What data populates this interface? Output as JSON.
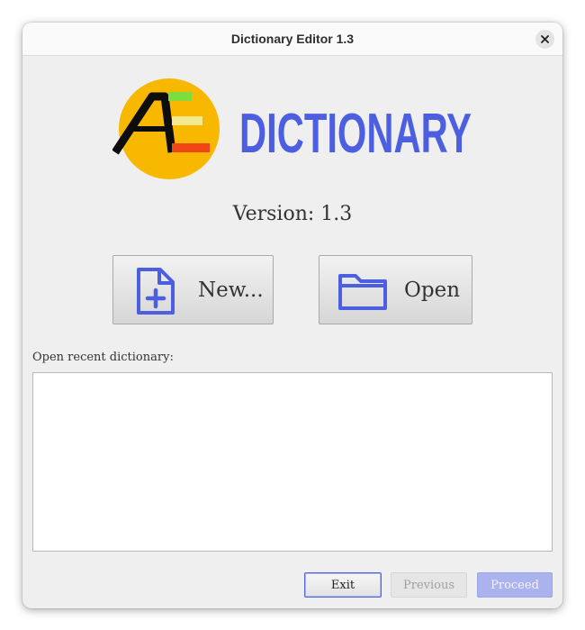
{
  "window": {
    "title": "Dictionary Editor 1.3"
  },
  "logo": {
    "wordmark": "DICTIONARY",
    "icon": "ae-logo-icon",
    "colors": {
      "circle": "#f8b800",
      "wordmark": "#4c5fe0",
      "bar_top": "#7ddd3c",
      "bar_mid": "#f2e890",
      "bar_bottom": "#f04515"
    }
  },
  "version_text": "Version: 1.3",
  "actions": {
    "new_label": "New...",
    "new_icon": "new-file-icon",
    "open_label": "Open",
    "open_icon": "folder-icon"
  },
  "recent": {
    "label": "Open recent dictionary:",
    "items": []
  },
  "footer": {
    "exit_label": "Exit",
    "previous_label": "Previous",
    "proceed_label": "Proceed",
    "previous_enabled": false,
    "proceed_enabled": false
  },
  "colors": {
    "accent": "#4c5fe0"
  }
}
